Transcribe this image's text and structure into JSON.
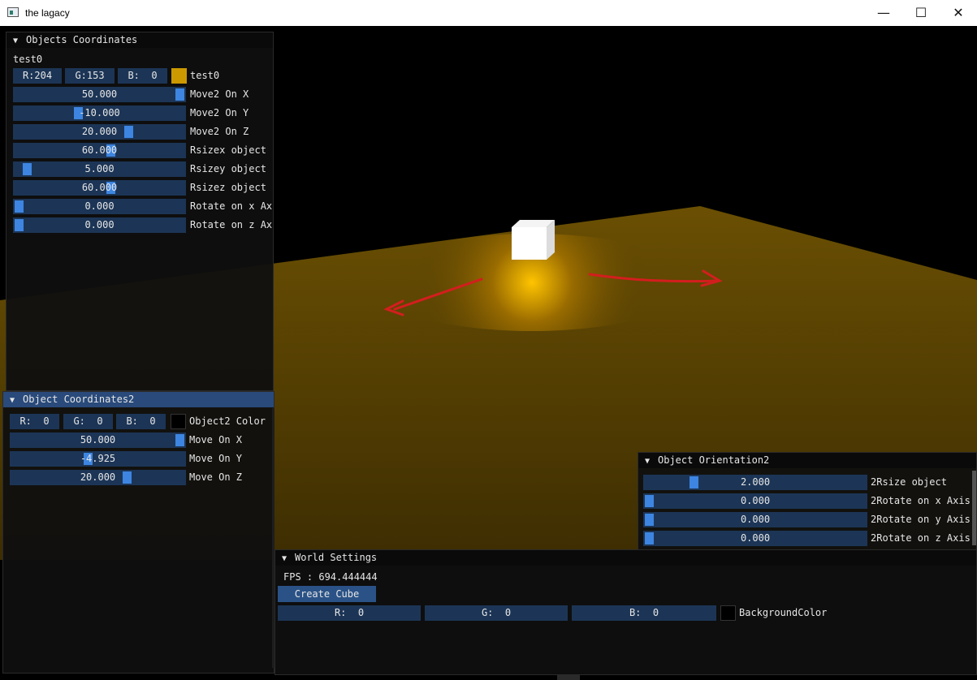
{
  "window": {
    "title": "the lagacy",
    "minimize": "—",
    "maximize": "☐",
    "close": "✕"
  },
  "colors": {
    "floor": "#5a4302",
    "accent": "#3d85e0",
    "field_bg": "#1c3556",
    "title_active": "#294a7a",
    "arrow": "#d31e1e"
  },
  "panel1": {
    "title": "Objects Coordinates",
    "object_name": "test0",
    "rgb": {
      "r": "R:204",
      "g": "G:153",
      "b": "B:  0"
    },
    "color_label": "test0",
    "swatch": "#cc9900",
    "sliders": [
      {
        "value": "50.000",
        "label": "Move2 On X",
        "level": 1.0
      },
      {
        "value": "-10.000",
        "label": "Move2 On Y",
        "level": 0.37
      },
      {
        "value": "20.000",
        "label": "Move2 On Z",
        "level": 0.68
      },
      {
        "value": "60.000",
        "label": "Rsizex object",
        "level": 0.57
      },
      {
        "value": "5.000",
        "label": "Rsizey object",
        "level": 0.05
      },
      {
        "value": "60.000",
        "label": "Rsizez object",
        "level": 0.57
      },
      {
        "value": "0.000",
        "label": "Rotate on x Ax",
        "level": 0.0
      },
      {
        "value": "0.000",
        "label": "Rotate on z Ax",
        "level": 0.0
      }
    ]
  },
  "panel2": {
    "title": "Object Coordinates2",
    "rgb": {
      "r": "R:  0",
      "g": "G:  0",
      "b": "B:  0"
    },
    "color_label": "Object2 Color",
    "swatch": "#000000",
    "sliders": [
      {
        "value": "50.000",
        "label": "Move On X",
        "level": 1.0
      },
      {
        "value": "-4.925",
        "label": "Move On Y",
        "level": 0.44
      },
      {
        "value": "20.000",
        "label": "Move On Z",
        "level": 0.68
      }
    ]
  },
  "panel3": {
    "title": "Object Orientation2",
    "sliders": [
      {
        "value": "2.000",
        "label": "2Rsize object",
        "level": 0.21
      },
      {
        "value": "0.000",
        "label": "2Rotate on x Axis",
        "level": 0.0
      },
      {
        "value": "0.000",
        "label": "2Rotate on y Axis",
        "level": 0.0
      },
      {
        "value": "0.000",
        "label": "2Rotate on z Axis",
        "level": 0.0
      }
    ]
  },
  "panel4": {
    "title": "World Settings",
    "fps": "FPS : 694.444444",
    "create_button": "Create Cube",
    "rgb": {
      "r": "R:  0",
      "g": "G:  0",
      "b": "B:  0"
    },
    "color_label": "BackgroundColor",
    "swatch": "#000000"
  }
}
